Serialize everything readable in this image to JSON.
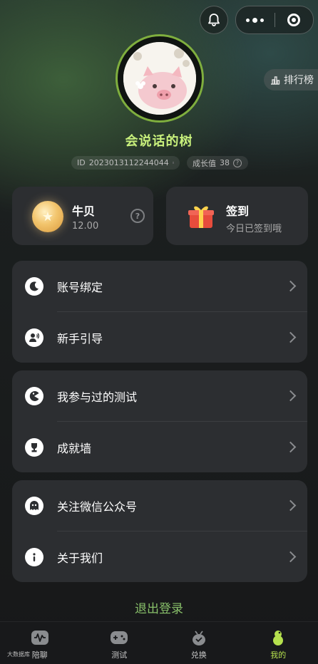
{
  "header": {
    "rank_label": "排行榜"
  },
  "profile": {
    "name": "会说话的树",
    "id_label": "ID",
    "id_value": "2023013112244044",
    "growth_label": "成长值",
    "growth_value": "38"
  },
  "cards": {
    "coins": {
      "title": "牛贝",
      "value": "12.00"
    },
    "checkin": {
      "title": "签到",
      "subtitle": "今日已签到哦"
    }
  },
  "menu": {
    "group1": [
      {
        "label": "账号绑定",
        "icon": "moon-icon"
      },
      {
        "label": "新手引导",
        "icon": "user-speaker-icon"
      }
    ],
    "group2": [
      {
        "label": "我参与过的测试",
        "icon": "pacman-icon"
      },
      {
        "label": "成就墙",
        "icon": "trophy-icon"
      }
    ],
    "group3": [
      {
        "label": "关注微信公众号",
        "icon": "ghost-icon"
      },
      {
        "label": "关于我们",
        "icon": "info-icon"
      }
    ]
  },
  "logout_label": "退出登录",
  "nav": {
    "tabs": [
      {
        "label": "陪聊",
        "icon": "waveform-icon"
      },
      {
        "label": "测试",
        "icon": "gamepad-icon"
      },
      {
        "label": "兑换",
        "icon": "bag-icon"
      },
      {
        "label": "我的",
        "icon": "gourd-icon"
      }
    ],
    "active_color": "#b5e04e"
  },
  "overlay_text": "大数据库"
}
